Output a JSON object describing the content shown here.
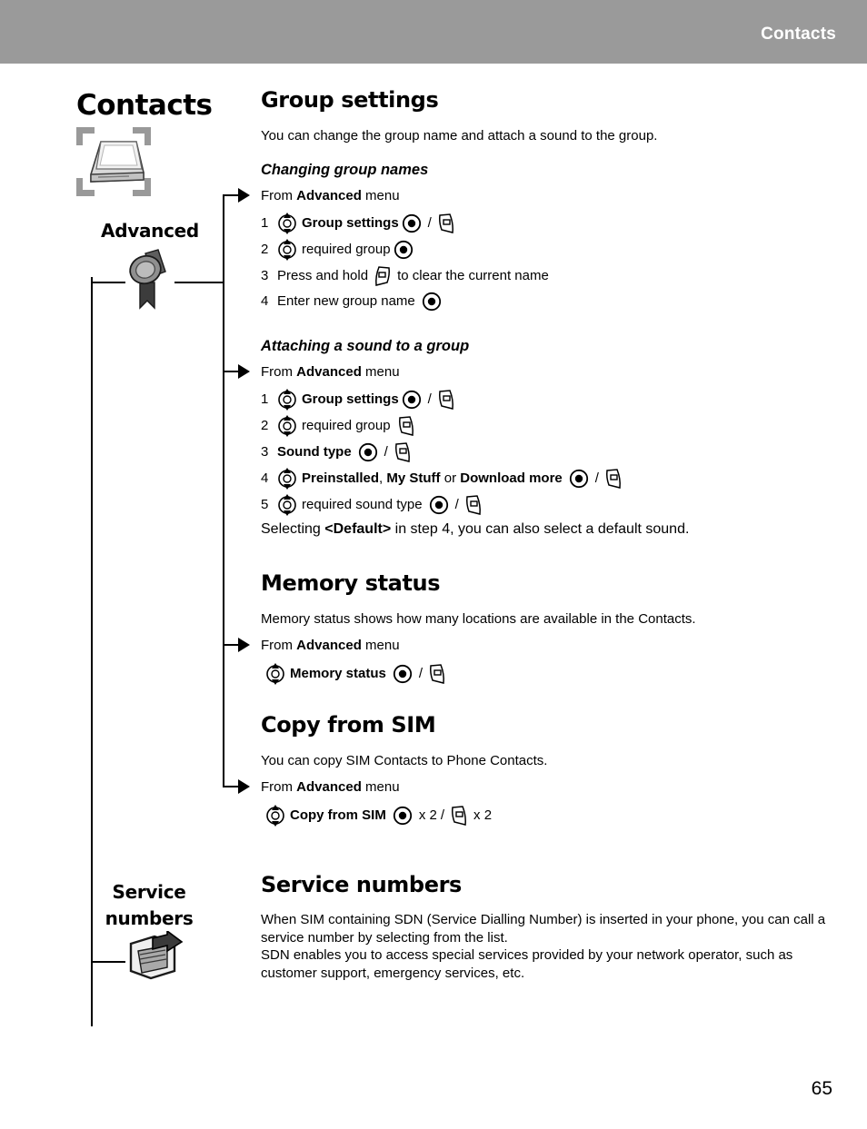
{
  "header": {
    "title": "Contacts"
  },
  "sidebar": {
    "chapter_title": "Contacts",
    "items": [
      {
        "label": "Advanced",
        "icon": "medal-icon"
      },
      {
        "label": "Service\nnumbers",
        "label_line1": "Service",
        "label_line2": "numbers",
        "icon": "sim-export-icon"
      }
    ],
    "chapter_icon": "contacts-card-icon"
  },
  "content": {
    "sections": [
      {
        "id": "group-settings",
        "title": "Group settings",
        "intro": "You can change the group name and attach a sound to the group.",
        "subsections": [
          {
            "id": "changing-group-names",
            "title": "Changing group names",
            "from_prefix": "From",
            "from_menu": "Advanced",
            "from_suffix": "menu",
            "steps": [
              {
                "num": "1",
                "nav": true,
                "text_bold": "Group settings",
                "text_plain": "",
                "ok": true,
                "slash": "/",
                "softkey": "right"
              },
              {
                "num": "2",
                "nav": true,
                "text_bold": "",
                "text_plain": "required group",
                "ok": true,
                "slash": "",
                "softkey": ""
              },
              {
                "num": "3",
                "nav": false,
                "text_plain_pre": "Press and hold",
                "softkey": "left",
                "text_plain_post": "to clear the current name"
              },
              {
                "num": "4",
                "nav": false,
                "text_plain_pre": "Enter new group name",
                "ok": true
              }
            ]
          },
          {
            "id": "attaching-a-sound-to-a-group",
            "title": "Attaching a sound to a group",
            "from_prefix": "From",
            "from_menu": "Advanced",
            "from_suffix": "menu",
            "steps": [
              {
                "num": "1",
                "nav": true,
                "text_bold": "Group settings",
                "ok": true,
                "slash": "/",
                "softkey": "right"
              },
              {
                "num": "2",
                "nav": true,
                "text_plain": "required group",
                "ok": false,
                "softkey": "right"
              },
              {
                "num": "3",
                "nav": false,
                "text_bold": "Sound type",
                "ok": true,
                "slash": "/",
                "softkey": "right"
              },
              {
                "num": "4",
                "nav": true,
                "rich": "Preinstalled, My Stuff or Download more",
                "ok": true,
                "slash": "/",
                "softkey": "right"
              },
              {
                "num": "5",
                "nav": true,
                "text_plain": "required sound type",
                "ok": true,
                "slash": "/",
                "softkey": "right"
              }
            ],
            "note_pre": "Selecting",
            "note_bold": "<Default>",
            "note_post": "in step 4, you can also select a default sound."
          }
        ]
      },
      {
        "id": "memory-status",
        "title": "Memory status",
        "intro": "Memory status shows how many locations are available in the Contacts.",
        "from_prefix": "From",
        "from_menu": "Advanced",
        "from_suffix": "menu",
        "action": {
          "nav": true,
          "text_bold": "Memory status",
          "ok": true,
          "slash": "/",
          "softkey": "right"
        }
      },
      {
        "id": "copy-from-sim",
        "title": "Copy from SIM",
        "intro": "You can copy SIM Contacts to Phone Contacts.",
        "from_prefix": "From",
        "from_menu": "Advanced",
        "from_suffix": "menu",
        "action": {
          "nav": true,
          "text_bold": "Copy from SIM",
          "ok": true,
          "ok_mult": "x 2",
          "slash": "/",
          "softkey": "right",
          "soft_mult": "x 2"
        }
      },
      {
        "id": "service-numbers",
        "title": "Service numbers",
        "paragraphs": [
          "When SIM containing SDN (Service Dialling Number) is inserted in your phone, you can call a service number by selecting from the list.",
          "SDN enables you to access special services provided by your network operator, such as customer support, emergency services, etc."
        ]
      }
    ]
  },
  "footer": {
    "page_number": "65"
  },
  "colors": {
    "header_bar": "#9a9a9a",
    "header_text": "#ffffff",
    "body_text": "#000000"
  }
}
